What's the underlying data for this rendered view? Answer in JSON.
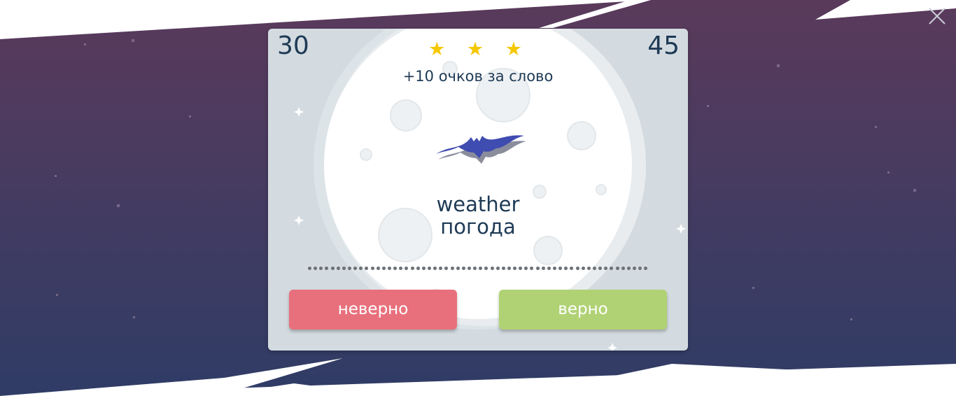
{
  "game": {
    "score_left": "30",
    "score_right": "45",
    "stars": [
      "★",
      "★",
      "★"
    ],
    "points_text": "+10 очков за слово",
    "word": "weather",
    "translation": "погода",
    "creature_icon": "bat-icon",
    "timer_dots_count": 60
  },
  "buttons": {
    "wrong_label": "неверно",
    "right_label": "верно"
  },
  "colors": {
    "sky_top": "#573a5c",
    "sky_bottom": "#313a65",
    "card_bg": "#d3dbe0",
    "moon": "#ffffff",
    "text": "#1e3a55",
    "star": "#f5c800",
    "wrong_button": "#e8707c",
    "right_button": "#b0d274",
    "bat": "#3f4cb0"
  }
}
